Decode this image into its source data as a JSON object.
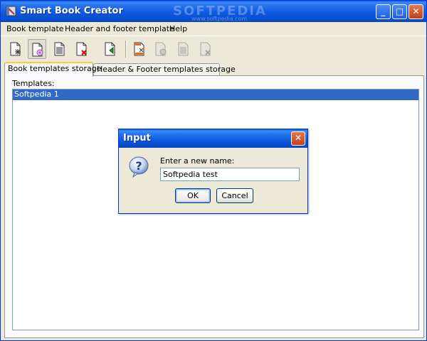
{
  "window": {
    "title": "Smart Book Creator",
    "watermark": "SOFTPEDIA",
    "watermark_sub": "www.softpedia.com",
    "controls": {
      "minimize": "_",
      "maximize": "□",
      "close": "✕"
    }
  },
  "menu": [
    {
      "label": "Book template"
    },
    {
      "label": "Header and footer template"
    },
    {
      "label": "Help"
    }
  ],
  "toolbar": {
    "tools": [
      {
        "icon": "new-template-icon",
        "state": "normal"
      },
      {
        "icon": "edit-template-icon",
        "state": "pressed"
      },
      {
        "icon": "template-list-icon",
        "state": "normal"
      },
      {
        "icon": "delete-template-icon",
        "state": "normal"
      },
      {
        "icon": "export-icon",
        "state": "normal"
      },
      {
        "icon": "header-footer-new-icon",
        "state": "normal"
      },
      {
        "icon": "header-footer-edit-icon",
        "state": "disabled"
      },
      {
        "icon": "header-footer-list-icon",
        "state": "disabled"
      },
      {
        "icon": "header-footer-delete-icon",
        "state": "disabled"
      }
    ]
  },
  "tabs": [
    {
      "label": "Book templates storage",
      "active": true
    },
    {
      "label": "Header & Footer templates storage",
      "active": false
    }
  ],
  "panel": {
    "templates_label": "Templates:",
    "items": [
      {
        "label": "Softpedia 1",
        "selected": true
      }
    ]
  },
  "dialog": {
    "title": "Input",
    "close": "✕",
    "prompt": "Enter a new name:",
    "input_value": "Softpedia test",
    "ok_label": "OK",
    "cancel_label": "Cancel"
  },
  "colors": {
    "titlebar": "#0a5fd8",
    "selection": "#316ac5",
    "window_bg": "#ece9d8"
  }
}
